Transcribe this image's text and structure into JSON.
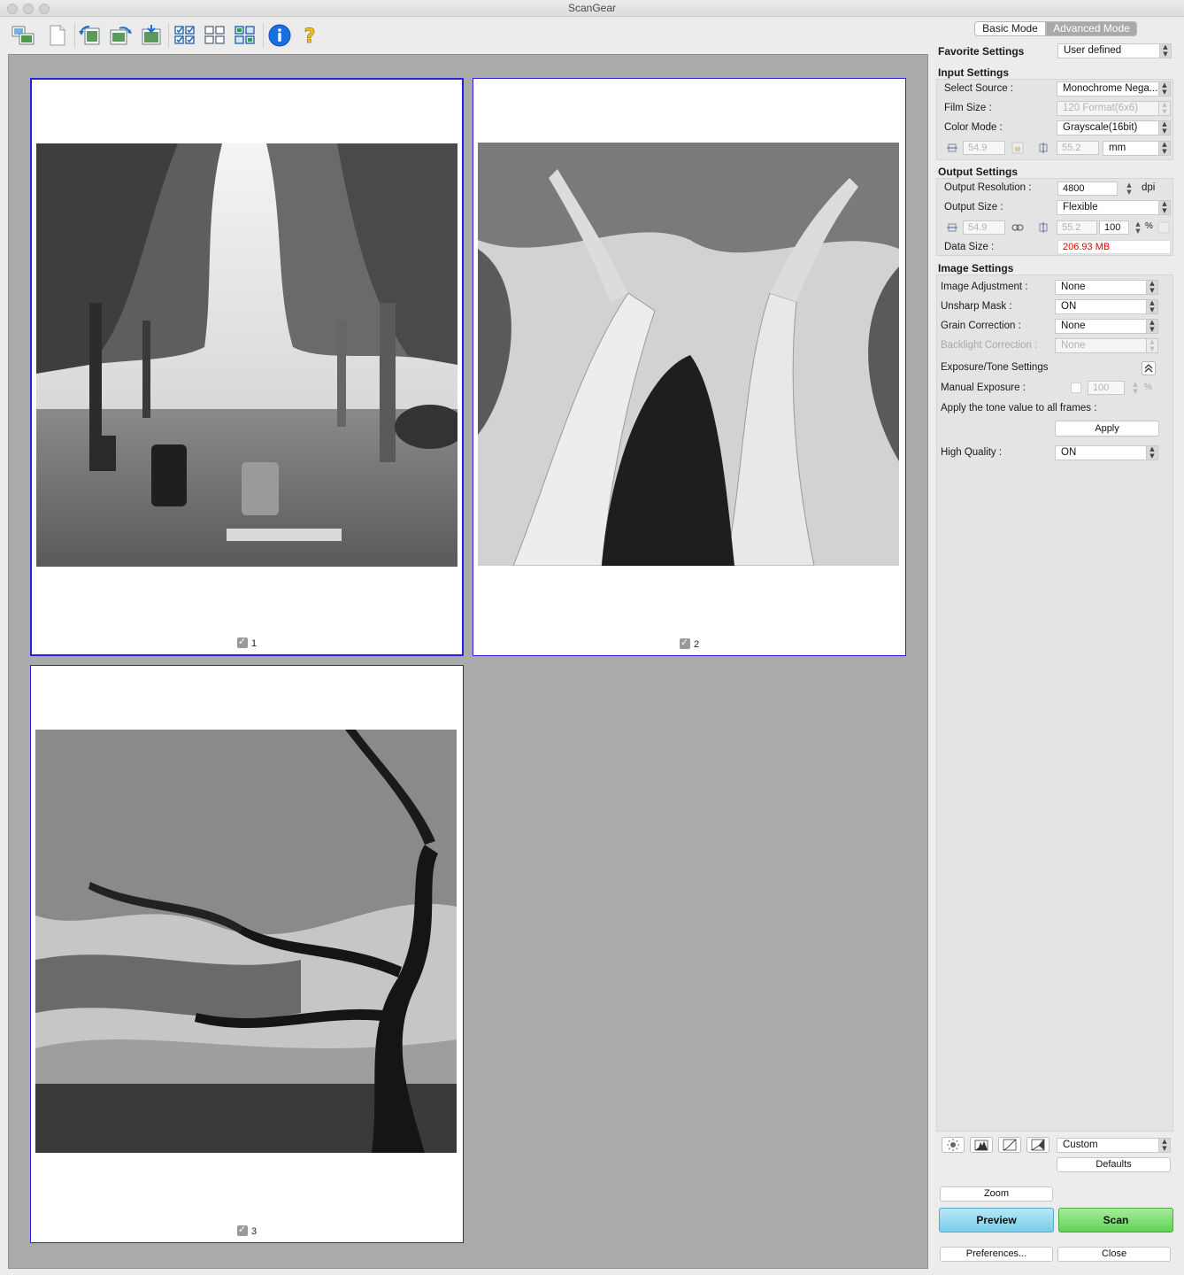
{
  "window": {
    "title": "ScanGear"
  },
  "modes": {
    "basic": "Basic Mode",
    "advanced": "Advanced Mode"
  },
  "favorite": {
    "label": "Favorite Settings",
    "value": "User defined"
  },
  "input_settings": {
    "title": "Input Settings",
    "source_label": "Select Source :",
    "source_value": "Monochrome Nega...",
    "film_label": "Film Size :",
    "film_value": "120 Format(6x6)",
    "color_label": "Color Mode :",
    "color_value": "Grayscale(16bit)",
    "width": "54.9",
    "height": "55.2",
    "unit": "mm"
  },
  "output_settings": {
    "title": "Output Settings",
    "res_label": "Output Resolution :",
    "res_value": "4800",
    "res_unit": "dpi",
    "size_label": "Output Size :",
    "size_value": "Flexible",
    "width": "54.9",
    "height": "55.2",
    "scale": "100",
    "scale_unit": "%",
    "data_label": "Data Size :",
    "data_value": "206.93 MB"
  },
  "image_settings": {
    "title": "Image Settings",
    "adj_label": "Image Adjustment :",
    "adj_value": "None",
    "unsharp_label": "Unsharp Mask :",
    "unsharp_value": "ON",
    "grain_label": "Grain Correction :",
    "grain_value": "None",
    "backlight_label": "Backlight Correction :",
    "backlight_value": "None",
    "exposure_label": "Exposure/Tone Settings",
    "manual_label": "Manual Exposure :",
    "manual_value": "100",
    "manual_unit": "%",
    "apply_tone_label": "Apply the tone value to all frames :",
    "apply_button": "Apply",
    "hq_label": "High Quality :",
    "hq_value": "ON"
  },
  "bottom": {
    "tone_preset": "Custom",
    "defaults": "Defaults",
    "zoom": "Zoom",
    "preview": "Preview",
    "scan": "Scan",
    "preferences": "Preferences...",
    "close": "Close"
  },
  "frames": [
    {
      "number": "1"
    },
    {
      "number": "2"
    },
    {
      "number": "3"
    }
  ],
  "colors": {
    "frame_border": "#2a20e0",
    "preview_button": "#8fd8ef",
    "scan_button": "#77de6a",
    "data_size": "#e00000"
  }
}
